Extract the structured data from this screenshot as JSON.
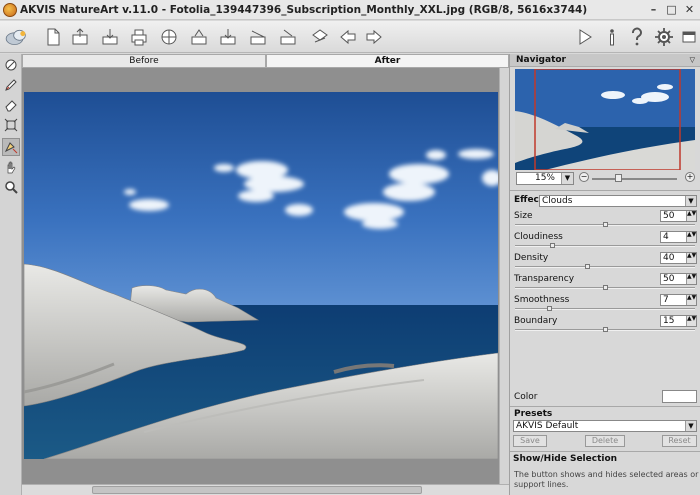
{
  "window": {
    "title": "AKVIS NatureArt v.11.0 - Fotolia_139447396_Subscription_Monthly_XXL.jpg (RGB/8, 5616x3744)",
    "minimize": "–",
    "maximize": "□",
    "close": "✕"
  },
  "toolbar": {
    "buttons": [
      "new-document",
      "open",
      "save",
      "print",
      "publish",
      "batch",
      "before",
      "after",
      "share",
      "help-before",
      "brush",
      "undo",
      "redo"
    ],
    "right_buttons": [
      "run",
      "about",
      "help",
      "settings"
    ]
  },
  "tools": [
    "preview-brush",
    "brush",
    "eraser",
    "crop",
    "selection",
    "hand",
    "zoom"
  ],
  "tabs": {
    "before": "Before",
    "after": "After"
  },
  "navigator": {
    "title": "Navigator",
    "zoom": "15%",
    "zoom_fraction": 0.3
  },
  "effect": {
    "label": "Effect:",
    "value": "Clouds"
  },
  "params": [
    {
      "label": "Size",
      "value": "50",
      "fraction": 0.5
    },
    {
      "label": "Cloudiness",
      "value": "4",
      "fraction": 0.2
    },
    {
      "label": "Density",
      "value": "40",
      "fraction": 0.4
    },
    {
      "label": "Transparency",
      "value": "50",
      "fraction": 0.5
    },
    {
      "label": "Smoothness",
      "value": "7",
      "fraction": 0.18
    },
    {
      "label": "Boundary",
      "value": "15",
      "fraction": 0.5
    }
  ],
  "color_label": "Color",
  "presets": {
    "title": "Presets",
    "value": "AKVIS Default",
    "save": "Save",
    "delete": "Delete",
    "reset": "Reset"
  },
  "help": {
    "title": "Show/Hide Selection",
    "body": "The button shows and hides selected areas or support lines."
  },
  "colors": {
    "accent": "#c0392b",
    "sky": "#2b5fa6"
  }
}
